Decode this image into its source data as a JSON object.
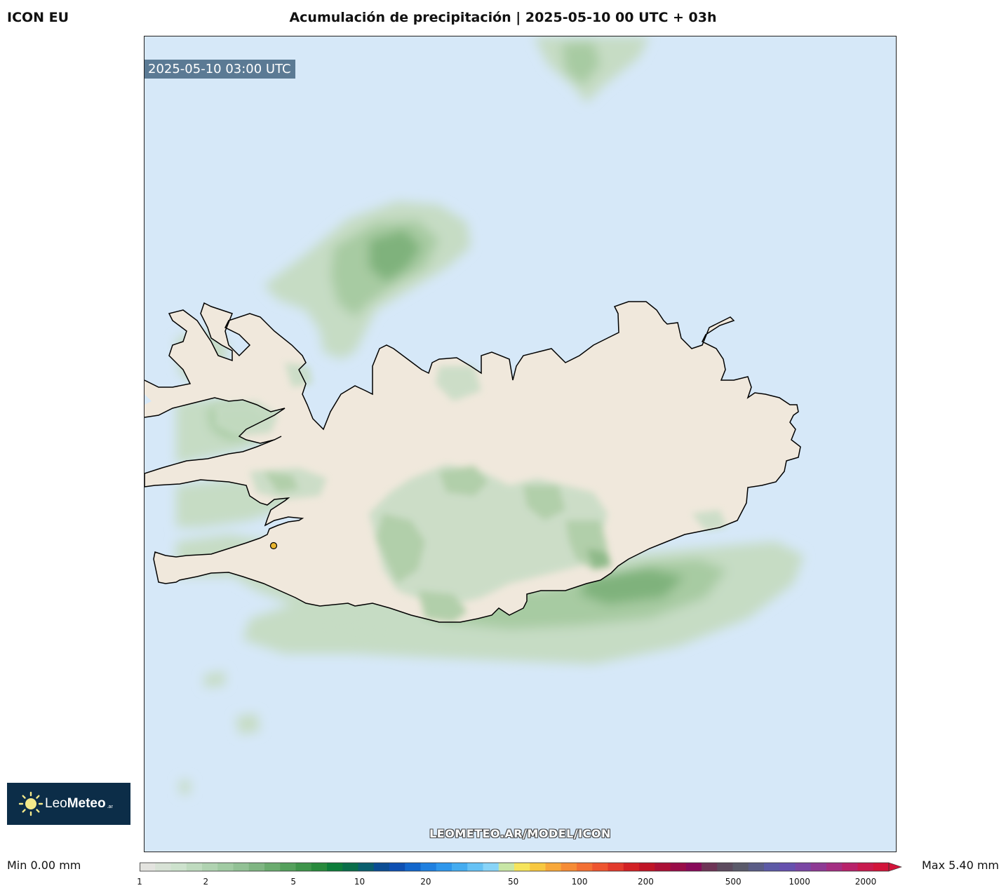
{
  "header": {
    "model": "ICON EU",
    "title": "Acumulación de precipitación | 2025-05-10 00 UTC + 03h"
  },
  "map": {
    "valid_time": "2025-05-10 03:00 UTC",
    "watermark": "LEOMETEO.AR/MODEL/ICON",
    "colors": {
      "ocean": "#d6e8f8",
      "land": "#f0e8dc",
      "coast": "#000000",
      "precip_light": "#c6dcc4",
      "precip_mid": "#a7cba2",
      "precip_heavy": "#7fb27c",
      "station": "#e8b530"
    }
  },
  "logo": {
    "prefix": "Leo",
    "brand": "Meteo",
    "suffix": ".ar"
  },
  "legend": {
    "min_label": "Min 0.00 mm",
    "max_label": "Max 5.40 mm",
    "ticks": [
      {
        "label": "1"
      },
      {
        "label": "2"
      },
      {
        "label": "5"
      },
      {
        "label": "10"
      },
      {
        "label": "20"
      },
      {
        "label": "50"
      },
      {
        "label": "100"
      },
      {
        "label": "200"
      },
      {
        "label": "500"
      },
      {
        "label": "1000"
      },
      {
        "label": "2000"
      }
    ],
    "colors": [
      "#e3e3df",
      "#d8e2d6",
      "#cde2cd",
      "#bfdbbf",
      "#b0d3b1",
      "#a1cba3",
      "#92c195",
      "#7fb582",
      "#6aab6e",
      "#54a05c",
      "#3e944a",
      "#288a3c",
      "#0d7d3a",
      "#0a6e4a",
      "#0a5f6e",
      "#0b4d94",
      "#0e4fb2",
      "#1266cc",
      "#1f80e0",
      "#2e97ec",
      "#44acf0",
      "#66c2f5",
      "#88d4f8",
      "#c8e6a6",
      "#f6e45c",
      "#f8c840",
      "#f8a83a",
      "#f68c36",
      "#f37034",
      "#ee5530",
      "#e23a2c",
      "#d22024",
      "#c01426",
      "#ac1036",
      "#9a0c48",
      "#880a5a",
      "#6e3456",
      "#5c4a5e",
      "#5a5a6a",
      "#5a5c86",
      "#5c5aa6",
      "#6650ae",
      "#7a46a4",
      "#8e3a94",
      "#a42e82",
      "#b8226a",
      "#c81a4e",
      "#d2143a"
    ]
  }
}
